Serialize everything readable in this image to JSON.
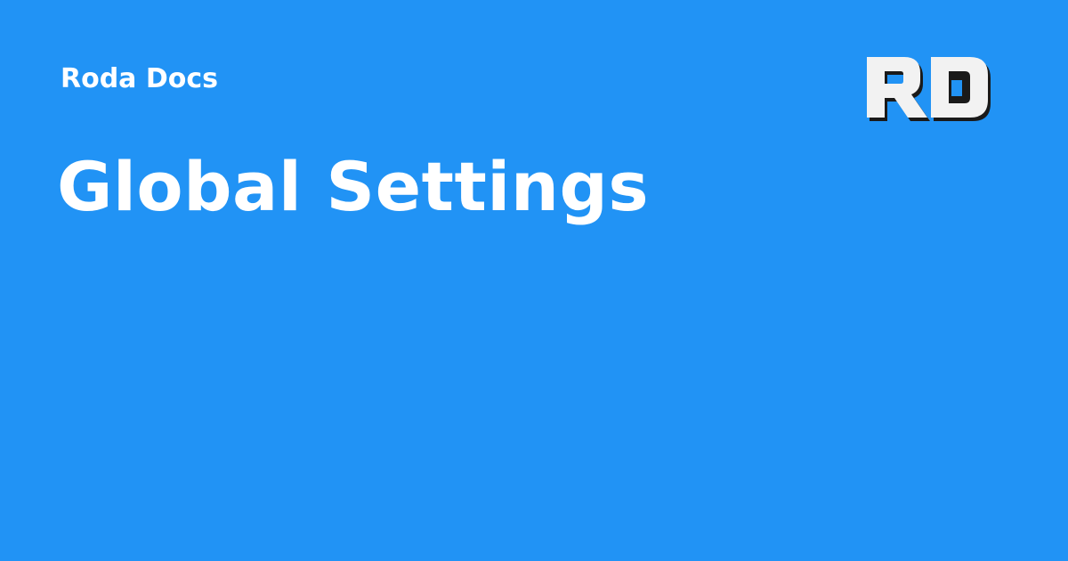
{
  "header": {
    "site_name": "Roda Docs"
  },
  "main": {
    "title": "Global Settings"
  },
  "logo": {
    "text": "RD",
    "icon": "rd-logo-icon"
  },
  "colors": {
    "background": "#2193f5",
    "text": "#ffffff",
    "logo_fill": "#f2f2f2",
    "logo_shadow": "#1a1a1a"
  }
}
